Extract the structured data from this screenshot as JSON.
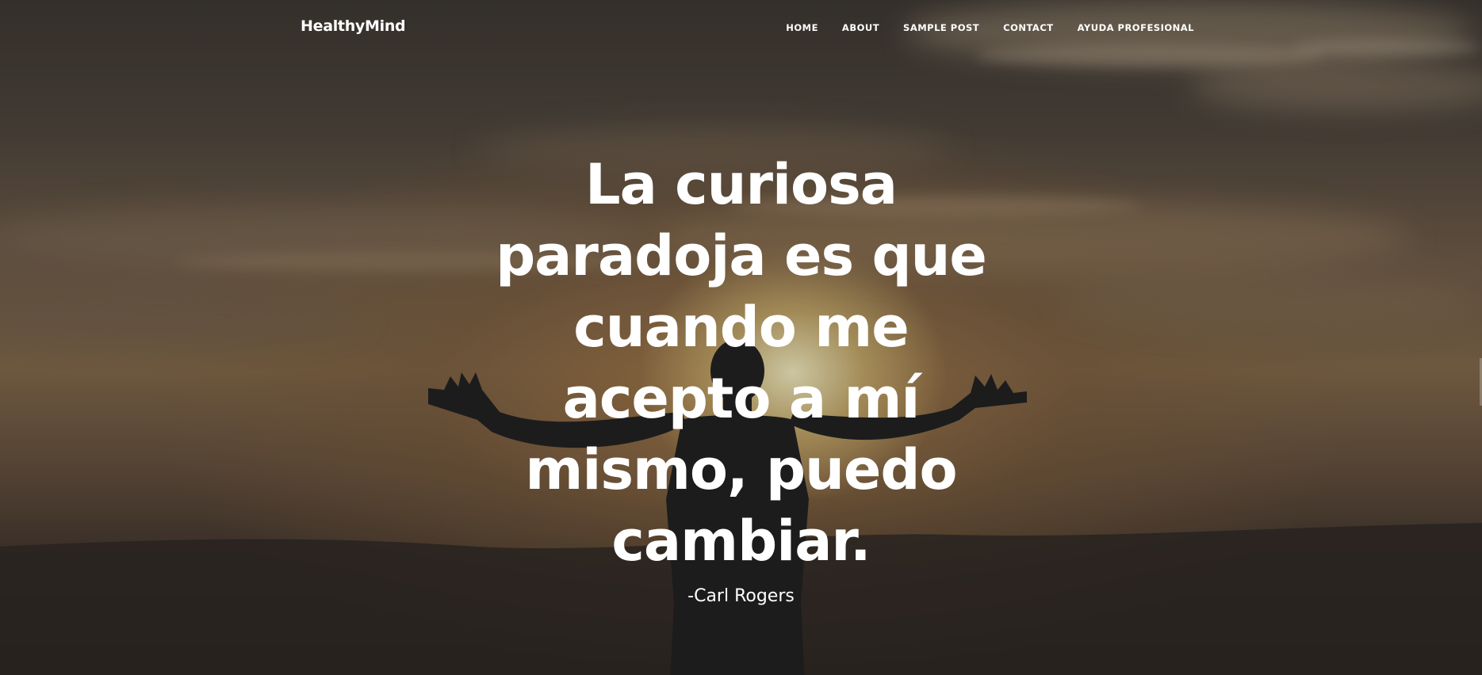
{
  "header": {
    "brand": "HealthyMind",
    "nav": [
      {
        "label": "HOME"
      },
      {
        "label": "ABOUT"
      },
      {
        "label": "SAMPLE POST"
      },
      {
        "label": "CONTACT"
      },
      {
        "label": "AYUDA PROFESIONAL"
      }
    ]
  },
  "hero": {
    "quote": "La curiosa paradoja es que cuando me acepto a mí mismo, puedo cambiar.",
    "author": "-Carl Rogers"
  }
}
